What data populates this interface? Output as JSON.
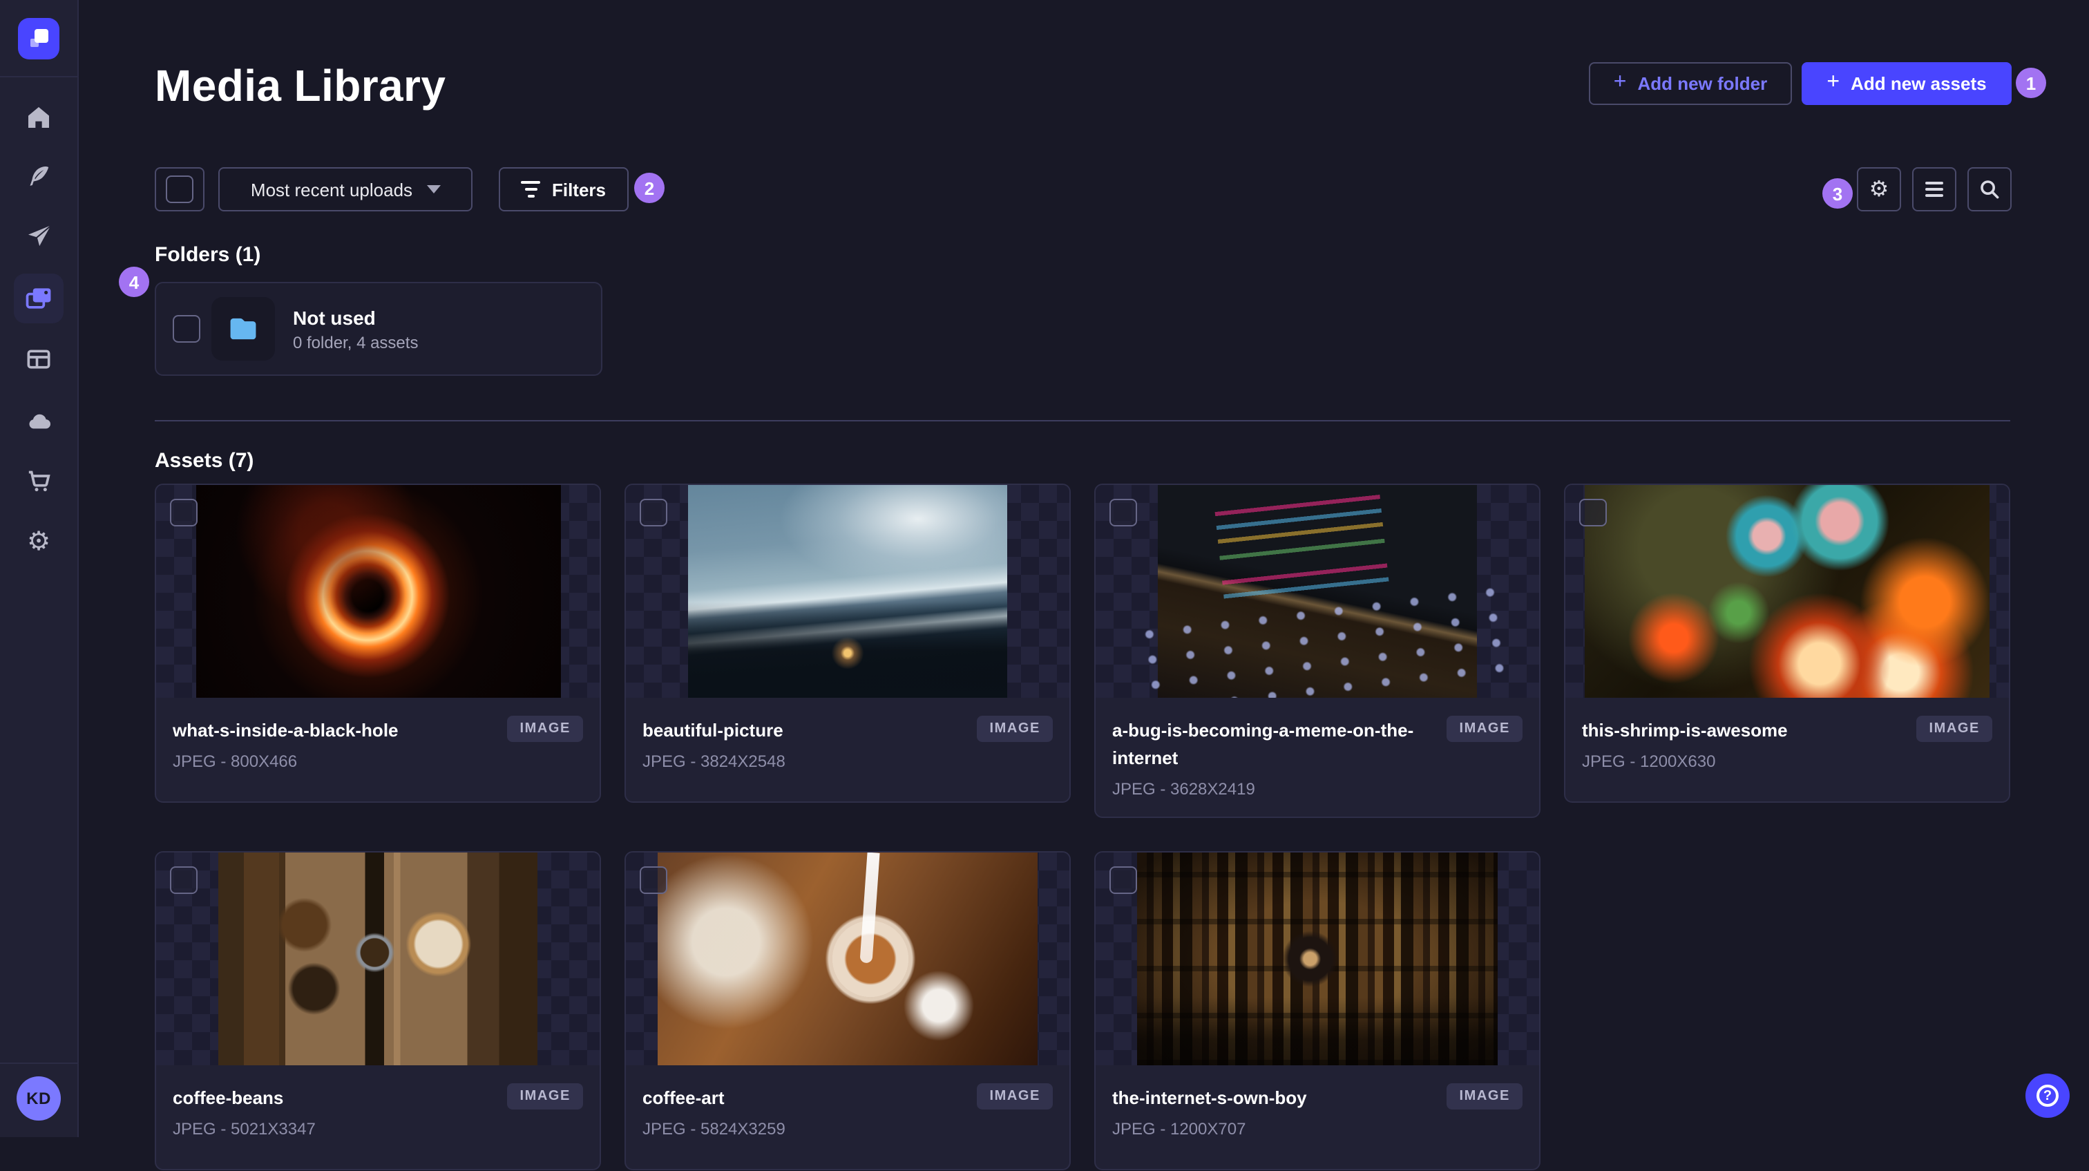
{
  "header": {
    "title": "Media Library",
    "add_folder_label": "Add new folder",
    "add_assets_label": "Add new assets",
    "plus_glyph": "+"
  },
  "toolbar": {
    "sort_value": "Most recent uploads",
    "filters_label": "Filters"
  },
  "annotations": [
    "1",
    "2",
    "3",
    "4"
  ],
  "sidebar": {
    "icons": [
      "home",
      "feather",
      "send",
      "media-library",
      "layout",
      "cloud",
      "cart",
      "settings"
    ],
    "active_item": "media-library",
    "avatar_initials": "KD",
    "settings_glyph": "⚙"
  },
  "folders": {
    "heading": "Folders (1)",
    "items": [
      {
        "name": "Not used",
        "meta": "0 folder, 4 assets"
      }
    ]
  },
  "assets": {
    "heading": "Assets (7)",
    "type_badge": "IMAGE",
    "items": [
      {
        "name": "what-s-inside-a-black-hole",
        "meta": "JPEG - 800X466",
        "art": "blackhole"
      },
      {
        "name": "beautiful-picture",
        "meta": "JPEG - 3824X2548",
        "art": "mountains"
      },
      {
        "name": "a-bug-is-becoming-a-meme-on-the-internet",
        "meta": "JPEG - 3628X2419",
        "art": "code"
      },
      {
        "name": "this-shrimp-is-awesome",
        "meta": "JPEG - 1200X630",
        "art": "shrimp"
      },
      {
        "name": "coffee-beans",
        "meta": "JPEG - 5021X3347",
        "art": "beans"
      },
      {
        "name": "coffee-art",
        "meta": "JPEG - 5824X3259",
        "art": "latte"
      },
      {
        "name": "the-internet-s-own-boy",
        "meta": "JPEG - 1200X707",
        "art": "library"
      }
    ]
  },
  "help": {
    "label": "?"
  },
  "colors": {
    "primary": "#4945ff",
    "primary_light": "#7b79ff",
    "annotation": "#a273f2",
    "folder_icon": "#66b7f1",
    "page_bg": "#181826",
    "card_bg": "#212134"
  }
}
